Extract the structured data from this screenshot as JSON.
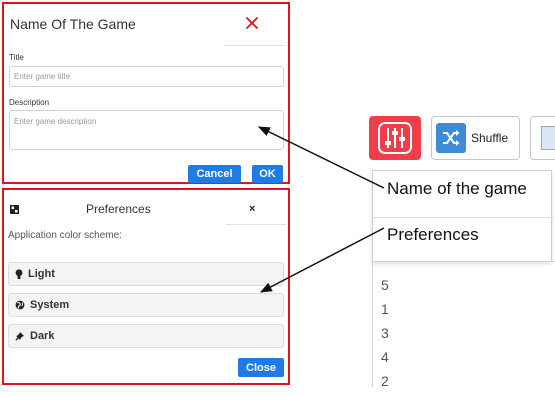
{
  "game_dialog": {
    "title": "Name Of The Game",
    "title_label": "Title",
    "title_placeholder": "Enter game title",
    "description_label": "Description",
    "description_placeholder": "Enter game description",
    "cancel_label": "Cancel",
    "ok_label": "OK",
    "close_icon": "close-icon",
    "border_color": "#e0141e",
    "accent_color": "#1e7ce4"
  },
  "preferences_dialog": {
    "title": "Preferences",
    "close_label": "×",
    "scheme_label": "Application color scheme:",
    "options": [
      {
        "label": "Light",
        "icon": "lightbulb-icon"
      },
      {
        "label": "System",
        "icon": "globe-icon"
      },
      {
        "label": "Dark",
        "icon": "pin-icon"
      }
    ],
    "close_button_label": "Close"
  },
  "app": {
    "toolbar": {
      "preferences_icon": "sliders-icon",
      "shuffle_label": "Shuffle",
      "shuffle_icon": "shuffle-icon",
      "third_icon": "document-icon",
      "preferences_button_color": "#ef3e4a",
      "shuffle_icon_color": "#3f8bd6"
    },
    "menu_items": [
      "Name of the game",
      "Preferences"
    ],
    "list_values": [
      "5",
      "1",
      "3",
      "4",
      "2"
    ]
  }
}
